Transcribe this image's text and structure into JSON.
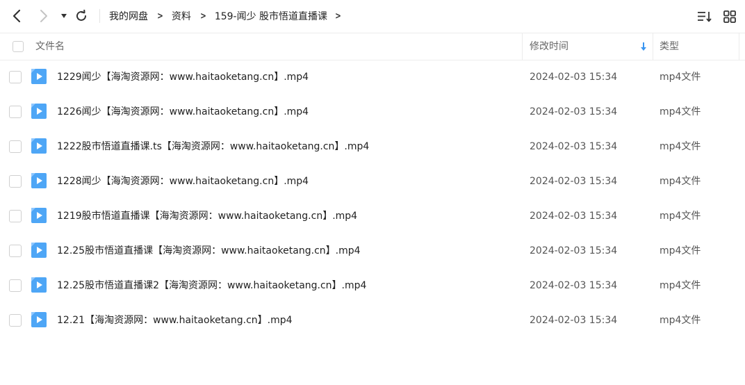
{
  "breadcrumb": {
    "items": [
      "我的网盘",
      "资料",
      "159-闻少 股市悟道直播课"
    ],
    "separator": ">"
  },
  "icons": {
    "back": "chevron-left-icon",
    "forward": "chevron-right-icon",
    "dropdown": "caret-down-icon",
    "refresh": "refresh-icon",
    "sort": "sort-list-icon",
    "grid": "grid-view-icon",
    "file": "video-file-icon",
    "sort_direction": "arrow-down-icon"
  },
  "colors": {
    "accent": "#3a95f0",
    "file_icon": "#4ea6f6"
  },
  "header": {
    "name_label": "文件名",
    "time_label": "修改时间",
    "type_label": "类型"
  },
  "files": [
    {
      "name": "1229闻少【海淘资源网：www.haitaoketang.cn】.mp4",
      "modified": "2024-02-03 15:34",
      "type": "mp4文件"
    },
    {
      "name": "1226闻少【海淘资源网：www.haitaoketang.cn】.mp4",
      "modified": "2024-02-03 15:34",
      "type": "mp4文件"
    },
    {
      "name": "1222股市悟道直播课.ts【海淘资源网：www.haitaoketang.cn】.mp4",
      "modified": "2024-02-03 15:34",
      "type": "mp4文件"
    },
    {
      "name": "1228闻少【海淘资源网：www.haitaoketang.cn】.mp4",
      "modified": "2024-02-03 15:34",
      "type": "mp4文件"
    },
    {
      "name": "1219股市悟道直播课【海淘资源网：www.haitaoketang.cn】.mp4",
      "modified": "2024-02-03 15:34",
      "type": "mp4文件"
    },
    {
      "name": "12.25股市悟道直播课【海淘资源网：www.haitaoketang.cn】.mp4",
      "modified": "2024-02-03 15:34",
      "type": "mp4文件"
    },
    {
      "name": "12.25股市悟道直播课2【海淘资源网：www.haitaoketang.cn】.mp4",
      "modified": "2024-02-03 15:34",
      "type": "mp4文件"
    },
    {
      "name": "12.21【海淘资源网：www.haitaoketang.cn】.mp4",
      "modified": "2024-02-03 15:34",
      "type": "mp4文件"
    }
  ]
}
